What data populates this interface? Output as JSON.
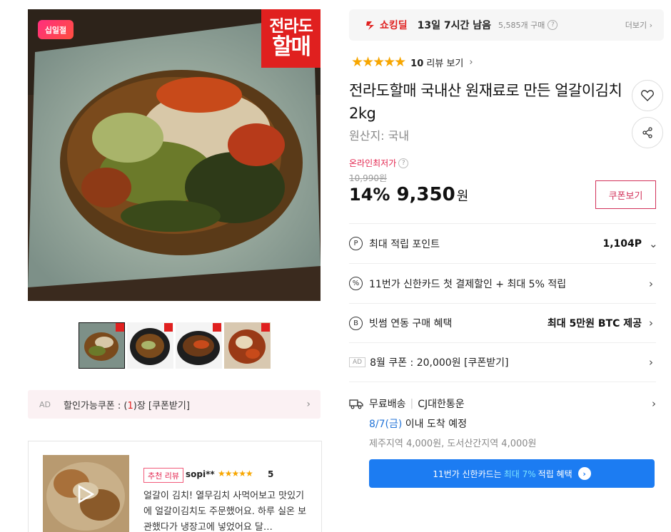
{
  "hero": {
    "badge": "십일절",
    "brand_mark_line1": "전라도",
    "brand_mark_line2": "할매"
  },
  "thumbnails": [
    "kimchi-plate",
    "kimchi-bowl-1",
    "kimchi-bowl-2",
    "kimchi-closeup"
  ],
  "coupon_bar": {
    "ad": "AD",
    "prefix": "할인가능쿠폰 : (",
    "count": "1",
    "suffix": ")장 [쿠폰받기]",
    "chevron": "›"
  },
  "review": {
    "tag": "추천 리뷰",
    "user": "sopi**",
    "stars": "★★★★★",
    "score": "5",
    "text": "얼갈이 김치! 열무김치 사먹어보고 맛있기에 얼갈이김치도 주문했어요. 하루 실온 보관했다가 냉장고에 넣었어요 달…"
  },
  "shocking": {
    "label": "쇼킹딜",
    "remaining": "13일 7시간 남음",
    "purchases": "5,585개 구매",
    "qm": "?",
    "more": "더보기 ›"
  },
  "rating": {
    "stars": "★★★★★",
    "count": "10",
    "count_suffix": " 리뷰 보기",
    "chevron": "›"
  },
  "product": {
    "title": "전라도할매 국내산 원재료로 만든 얼갈이김치 2kg",
    "origin": "원산지:  국내",
    "lowest_label": "온라인최저가",
    "original_price": "10,990원",
    "discount": "14%",
    "price": "9,350",
    "won": "원",
    "coupon_button": "쿠폰보기"
  },
  "benefits": [
    {
      "icon": "P",
      "label": "최대 적립 포인트",
      "value": "1,104P",
      "chevron": "⌄"
    },
    {
      "icon": "%",
      "label": "11번가 신한카드 첫 결제할인 + 최대 5% 적립",
      "value": "",
      "chevron": "›"
    },
    {
      "icon": "B",
      "label": "빗썸 연동 구매 혜택",
      "value": "최대 5만원 BTC 제공",
      "chevron": "›"
    },
    {
      "icon": "AD",
      "label": "8월 쿠폰 : 20,000원 [쿠폰받기]",
      "value": "",
      "chevron": "›"
    }
  ],
  "shipping": {
    "free": "무료배송",
    "carrier": "CJ대한통운",
    "date": "8/7(금)",
    "arrival_suffix": " 이내 도착 예정",
    "extra": "제주지역 4,000원, 도서산간지역 4,000원",
    "chevron": "›"
  },
  "card_banner": {
    "prefix": "11번가 신한카드는",
    "highlight": "최대 7%",
    "suffix": "적립 혜택",
    "go": "›"
  }
}
